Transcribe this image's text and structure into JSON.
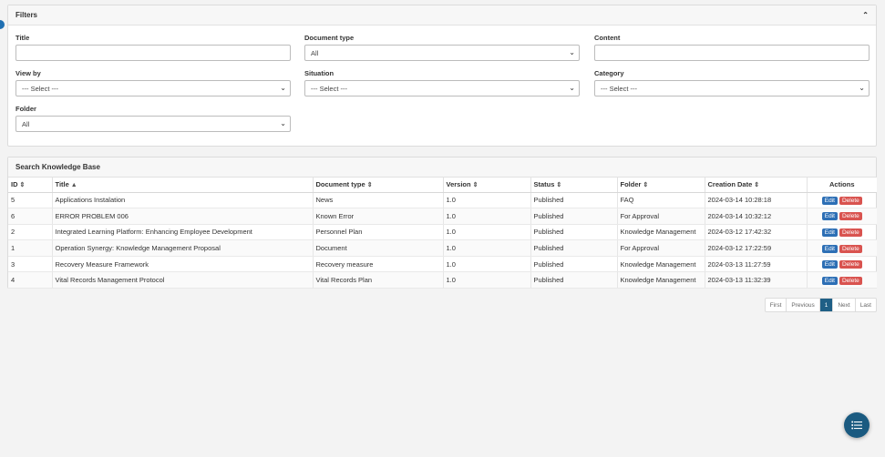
{
  "filters": {
    "title": "Filters",
    "fields": {
      "title_label": "Title",
      "doctype_label": "Document type",
      "doctype_value": "All",
      "content_label": "Content",
      "viewby_label": "View by",
      "viewby_value": "--- Select ---",
      "situation_label": "Situation",
      "situation_value": "--- Select ---",
      "category_label": "Category",
      "category_value": "--- Select ---",
      "folder_label": "Folder",
      "folder_value": "All"
    }
  },
  "search": {
    "title": "Search Knowledge Base",
    "columns": [
      "ID",
      "Title",
      "Document type",
      "Version",
      "Status",
      "Folder",
      "Creation Date",
      "Actions"
    ],
    "rows": [
      {
        "id": "5",
        "title": "Applications Instalation",
        "doctype": "News",
        "version": "1.0",
        "status": "Published",
        "folder": "FAQ",
        "date": "2024-03-14 10:28:18"
      },
      {
        "id": "6",
        "title": "ERROR PROBLEM 006",
        "doctype": "Known Error",
        "version": "1.0",
        "status": "Published",
        "folder": "For Approval",
        "date": "2024-03-14 10:32:12"
      },
      {
        "id": "2",
        "title": "Integrated Learning Platform: Enhancing Employee Development",
        "doctype": "Personnel Plan",
        "version": "1.0",
        "status": "Published",
        "folder": "Knowledge Management",
        "date": "2024-03-12 17:42:32"
      },
      {
        "id": "1",
        "title": "Operation Synergy: Knowledge Management Proposal",
        "doctype": "Document",
        "version": "1.0",
        "status": "Published",
        "folder": "For Approval",
        "date": "2024-03-12 17:22:59"
      },
      {
        "id": "3",
        "title": "Recovery Measure Framework",
        "doctype": "Recovery measure",
        "version": "1.0",
        "status": "Published",
        "folder": "Knowledge Management",
        "date": "2024-03-13 11:27:59"
      },
      {
        "id": "4",
        "title": "Vital Records Management Protocol",
        "doctype": "Vital Records Plan",
        "version": "1.0",
        "status": "Published",
        "folder": "Knowledge Management",
        "date": "2024-03-13 11:32:39"
      }
    ],
    "actions": {
      "edit": "Edit",
      "delete": "Delete"
    }
  },
  "pagination": {
    "first": "First",
    "previous": "Previous",
    "current": "1",
    "next": "Next",
    "last": "Last"
  },
  "colors": {
    "primary": "#2d6fb5",
    "danger": "#d9534f",
    "fab": "#1a5a80",
    "active_page": "#1f5f86"
  }
}
